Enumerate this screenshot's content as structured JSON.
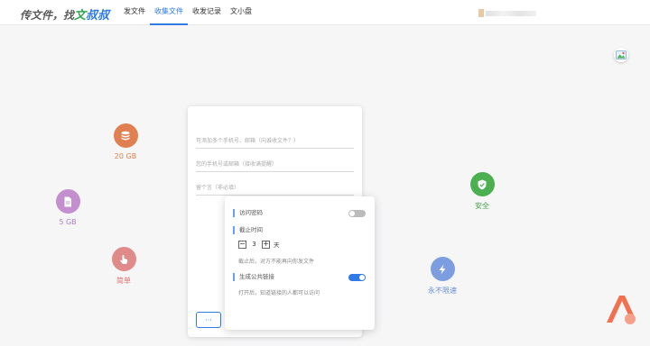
{
  "header": {
    "logo_prefix": "传文件，找",
    "logo_accent": "文",
    "logo_accent2": "叔叔",
    "nav": [
      "发文件",
      "收集文件",
      "收发记录",
      "文小盘"
    ],
    "active_nav": "收集文件"
  },
  "features": [
    {
      "label": "20 GB",
      "icon": "database-icon",
      "color": "#e08050",
      "text_color": "#e08050"
    },
    {
      "label": "5 GB",
      "icon": "file-icon",
      "color": "#c48fcf",
      "text_color": "#b07cc0"
    },
    {
      "label": "简单",
      "icon": "hand-pointer-icon",
      "color": "#e08a8a",
      "text_color": "#e07070"
    },
    {
      "label": "安全",
      "icon": "shield-check-icon",
      "color": "#4caf50",
      "text_color": "#43a047"
    },
    {
      "label": "永不限速",
      "icon": "lightning-icon",
      "color": "#7c9ee0",
      "text_color": "#6a8cd6"
    }
  ],
  "form": {
    "recipients_placeholder": "可添加多个手机号、邮箱（向谁收文件？）",
    "contact_placeholder": "您的手机号或邮箱（接收满提醒）",
    "message_placeholder": "留个言（非必填）",
    "more_label": "···"
  },
  "settings": {
    "password_label": "访问密码",
    "password_enabled": false,
    "deadline_label": "截止时间",
    "deadline_value": "3",
    "deadline_unit": "天",
    "deadline_hint": "截止后，对方不能再向你发文件",
    "public_link_label": "生成公共链接",
    "public_link_enabled": true,
    "public_link_hint": "打开后，知道链接的人都可以访问"
  },
  "colors": {
    "accent": "#2f7ae5",
    "logo_green": "#2fa84f",
    "brand_logo": "#f07050"
  }
}
